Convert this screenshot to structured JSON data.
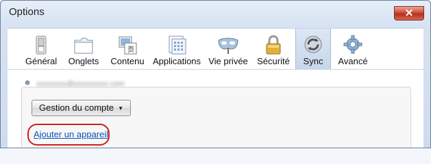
{
  "window": {
    "title": "Options",
    "close_glyph": "✕"
  },
  "toolbar": {
    "items": [
      {
        "label": "Général",
        "icon": "general-switch-icon"
      },
      {
        "label": "Onglets",
        "icon": "tabs-icon"
      },
      {
        "label": "Contenu",
        "icon": "content-icon"
      },
      {
        "label": "Applications",
        "icon": "applications-icon"
      },
      {
        "label": "Vie privée",
        "icon": "privacy-mask-icon"
      },
      {
        "label": "Sécurité",
        "icon": "padlock-icon"
      },
      {
        "label": "Sync",
        "icon": "sync-icon",
        "selected": true
      },
      {
        "label": "Avancé",
        "icon": "gear-icon"
      }
    ]
  },
  "sync": {
    "account_email": "xxxxxxxx@xxxxxxxxx.com",
    "manage_button": "Gestion du compte",
    "add_device_link": "Ajouter un appareil"
  },
  "colors": {
    "link": "#0a52b8",
    "highlight_circle": "#d31c1c",
    "selected_tab": "#c7d6ea"
  }
}
